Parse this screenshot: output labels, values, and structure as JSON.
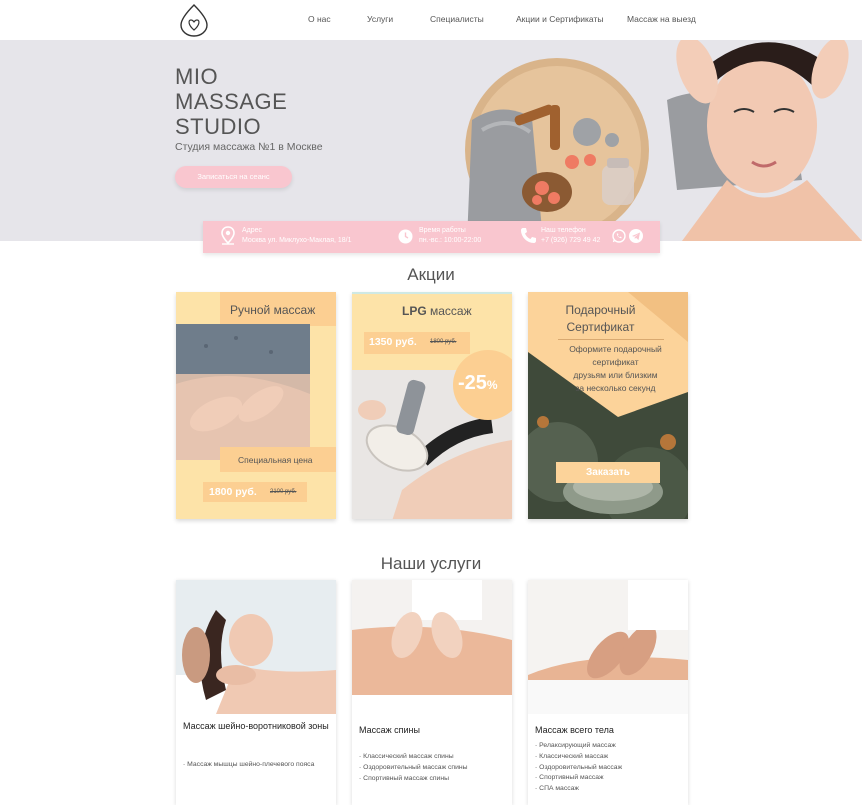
{
  "colors": {
    "accent_pink": "#f9c6cf",
    "accent_peach": "#fccf92",
    "hero_bg": "#e6e5ea"
  },
  "header": {
    "logo_icon": "lotus-heart-icon",
    "nav": [
      "О нас",
      "Услуги",
      "Специалисты",
      "Акции и Сертификаты",
      "Массаж на выезд"
    ]
  },
  "hero": {
    "title_lines": [
      "MIO",
      "MASSAGE",
      "STUDIO"
    ],
    "subtitle": "Студия массажа №1 в Москве",
    "cta": "Записаться на сеанс"
  },
  "infobar": {
    "address_label": "Адрес",
    "address_value": "Москва ул. Миклухо-Маклая, 18/1",
    "hours_label": "Время работы",
    "hours_value": "пн.-вс.: 10:00-22:00",
    "phone_label": "Наш телефон",
    "phone_value": "+7 (926) 729 49 42",
    "icons": [
      "map-pin-icon",
      "clock-icon",
      "phone-icon",
      "whatsapp-icon",
      "telegram-icon"
    ]
  },
  "promos": {
    "title": "Акции",
    "manual": {
      "title": "Ручной массаж",
      "tag": "Специальная цена",
      "price": "1800 руб.",
      "old_price": "2100 руб."
    },
    "lpg": {
      "title_bold": "LPG",
      "title_rest": " массаж",
      "price": "1350 руб.",
      "old_price": "1800 руб.",
      "discount": "-25",
      "percent": "%"
    },
    "gift": {
      "title_line1": "Подарочный",
      "title_line2": "Сертификат",
      "text_lines": [
        "Оформите подарочный",
        "сертификат",
        "друзьям или близким",
        "за несколько секунд"
      ],
      "button": "Заказать"
    }
  },
  "services": {
    "title": "Наши услуги",
    "cards": [
      {
        "title": "Массаж шейно-воротниковой зоны",
        "items": [
          "Массаж мышцы шейно-плечевого пояса"
        ]
      },
      {
        "title": "Массаж спины",
        "items": [
          "Классический массаж спины",
          "Оздоровительный массаж спины",
          "Спортивный массаж спины"
        ]
      },
      {
        "title": "Массаж всего тела",
        "items": [
          "Релаксирующий массаж",
          "Классический массаж",
          "Оздоровительный массаж",
          "Спортивный массаж",
          "СПА массаж"
        ]
      }
    ]
  }
}
